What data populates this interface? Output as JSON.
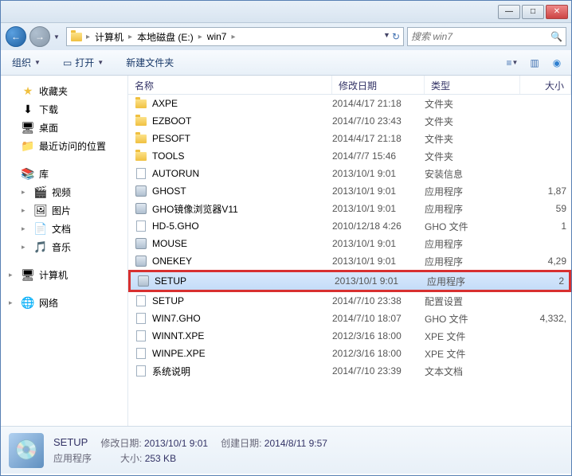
{
  "titlebar": {
    "minimize": "—",
    "maximize": "□",
    "close": "✕"
  },
  "nav": {
    "back_arrow": "←",
    "fwd_arrow": "→"
  },
  "breadcrumb": {
    "items": [
      "计算机",
      "本地磁盘 (E:)",
      "win7"
    ],
    "search_placeholder": "搜索 win7"
  },
  "toolbar": {
    "organize": "组织",
    "open": "打开",
    "newfolder": "新建文件夹"
  },
  "sidebar": {
    "favorites": {
      "label": "收藏夹",
      "items": [
        "下载",
        "桌面",
        "最近访问的位置"
      ]
    },
    "libraries": {
      "label": "库",
      "items": [
        "视频",
        "图片",
        "文档",
        "音乐"
      ]
    },
    "computer": {
      "label": "计算机"
    },
    "network": {
      "label": "网络"
    }
  },
  "columns": {
    "name": "名称",
    "date": "修改日期",
    "type": "类型",
    "size": "大小"
  },
  "files": [
    {
      "icon": "folder",
      "name": "AXPE",
      "date": "2014/4/17 21:18",
      "type": "文件夹",
      "size": ""
    },
    {
      "icon": "folder",
      "name": "EZBOOT",
      "date": "2014/7/10 23:43",
      "type": "文件夹",
      "size": ""
    },
    {
      "icon": "folder",
      "name": "PESOFT",
      "date": "2014/4/17 21:18",
      "type": "文件夹",
      "size": ""
    },
    {
      "icon": "folder",
      "name": "TOOLS",
      "date": "2014/7/7 15:46",
      "type": "文件夹",
      "size": ""
    },
    {
      "icon": "doc",
      "name": "AUTORUN",
      "date": "2013/10/1 9:01",
      "type": "安装信息",
      "size": ""
    },
    {
      "icon": "exe",
      "name": "GHOST",
      "date": "2013/10/1 9:01",
      "type": "应用程序",
      "size": "1,87"
    },
    {
      "icon": "exe",
      "name": "GHO镜像浏览器V11",
      "date": "2013/10/1 9:01",
      "type": "应用程序",
      "size": "59"
    },
    {
      "icon": "doc",
      "name": "HD-5.GHO",
      "date": "2010/12/18 4:26",
      "type": "GHO 文件",
      "size": "1"
    },
    {
      "icon": "exe",
      "name": "MOUSE",
      "date": "2013/10/1 9:01",
      "type": "应用程序",
      "size": ""
    },
    {
      "icon": "exe",
      "name": "ONEKEY",
      "date": "2013/10/1 9:01",
      "type": "应用程序",
      "size": "4,29"
    },
    {
      "icon": "exe",
      "name": "SETUP",
      "date": "2013/10/1 9:01",
      "type": "应用程序",
      "size": "2",
      "highlighted": true
    },
    {
      "icon": "doc",
      "name": "SETUP",
      "date": "2014/7/10 23:38",
      "type": "配置设置",
      "size": ""
    },
    {
      "icon": "doc",
      "name": "WIN7.GHO",
      "date": "2014/7/10 18:07",
      "type": "GHO 文件",
      "size": "4,332,"
    },
    {
      "icon": "doc",
      "name": "WINNT.XPE",
      "date": "2012/3/16 18:00",
      "type": "XPE 文件",
      "size": ""
    },
    {
      "icon": "doc",
      "name": "WINPE.XPE",
      "date": "2012/3/16 18:00",
      "type": "XPE 文件",
      "size": ""
    },
    {
      "icon": "doc",
      "name": "系统说明",
      "date": "2014/7/10 23:39",
      "type": "文本文档",
      "size": ""
    }
  ],
  "status": {
    "name": "SETUP",
    "type": "应用程序",
    "mod_label": "修改日期:",
    "mod_val": "2013/10/1 9:01",
    "size_label": "大小:",
    "size_val": "253 KB",
    "create_label": "创建日期:",
    "create_val": "2014/8/11 9:57"
  }
}
